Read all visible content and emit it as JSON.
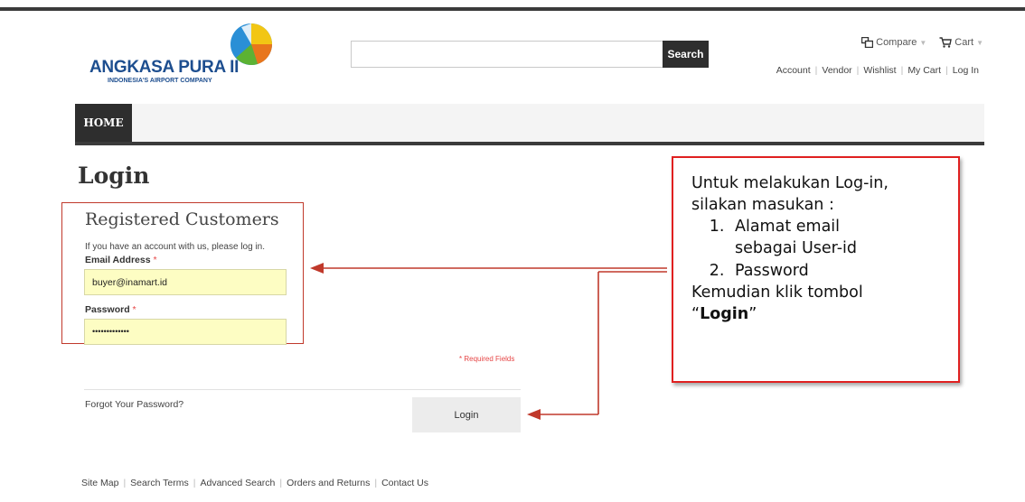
{
  "logo": {
    "name": "ANGKASA PURA II",
    "tagline": "INDONESIA'S AIRPORT COMPANY"
  },
  "search": {
    "value": "",
    "button_label": "Search"
  },
  "header": {
    "compare_label": "Compare",
    "cart_label": "Cart",
    "links": [
      "Account",
      "Vendor",
      "Wishlist",
      "My Cart",
      "Log In"
    ]
  },
  "nav": {
    "items": [
      "HOME"
    ]
  },
  "page": {
    "title": "Login"
  },
  "login_form": {
    "section_title": "Registered Customers",
    "description": "If you have an account with us, please log in.",
    "email_label": "Email Address",
    "email_value": "buyer@inamart.id",
    "password_label": "Password",
    "password_value": "•••••••••••••",
    "required_star": "*",
    "required_note": "* Required Fields",
    "forgot_link": "Forgot Your Password?",
    "login_button": "Login"
  },
  "footer": {
    "links": [
      "Site Map",
      "Search Terms",
      "Advanced Search",
      "Orders and Returns",
      "Contact Us"
    ]
  },
  "callout": {
    "line1": "Untuk melakukan Log-in,",
    "line2": "silakan masukan :",
    "item1_a": "Alamat email",
    "item1_b": "sebagai User-id",
    "item2": "Password",
    "line3": "Kemudian klik tombol",
    "quote_open": "“",
    "quote_word": "Login",
    "quote_close": "”"
  },
  "colors": {
    "accent_dark": "#2e2e2e",
    "highlight_red": "#c0392b",
    "input_yellow": "#fdfdc3",
    "logo_blue": "#1d4e8f"
  }
}
